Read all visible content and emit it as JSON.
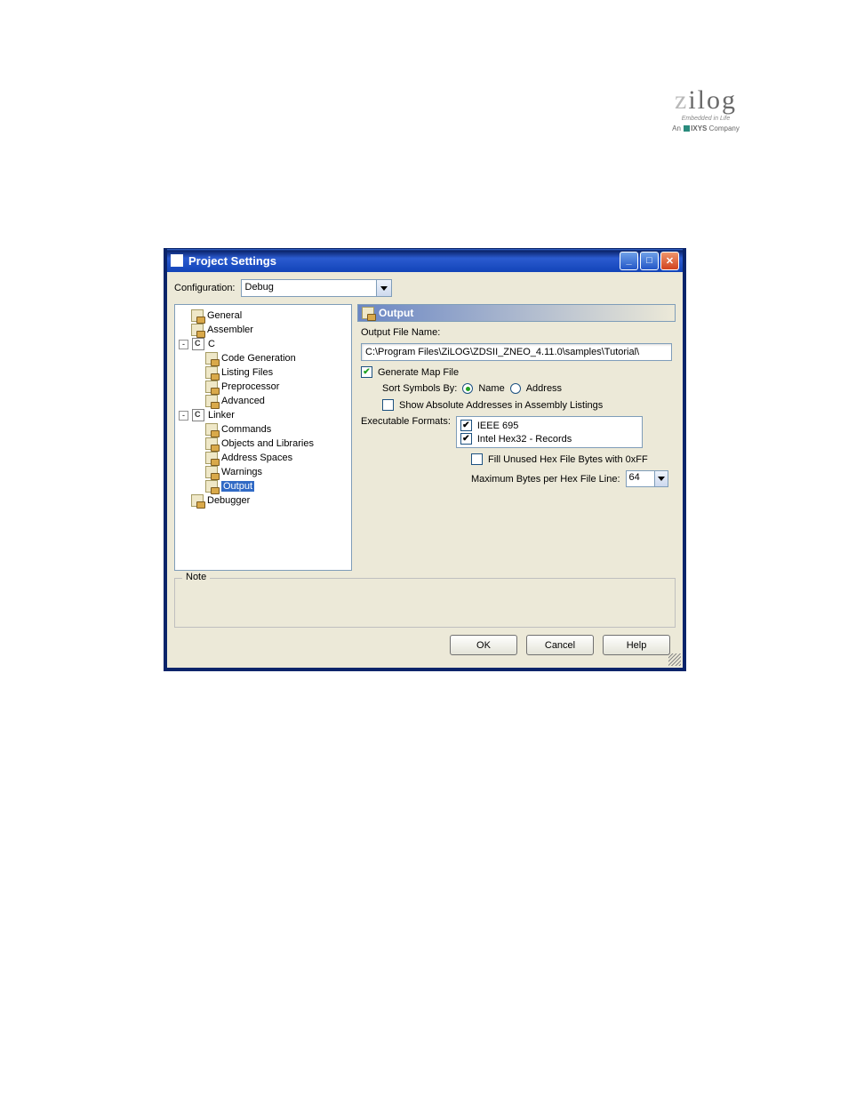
{
  "logo": {
    "brand": "zilog",
    "tagline": "Embedded in Life",
    "company": "An IXYS Company",
    "ixys": "IXYS"
  },
  "window": {
    "title": "Project Settings"
  },
  "config": {
    "label": "Configuration:",
    "value": "Debug"
  },
  "tree": {
    "general": "General",
    "assembler": "Assembler",
    "c": "C",
    "codegen": "Code Generation",
    "listing": "Listing Files",
    "preproc": "Preprocessor",
    "advanced": "Advanced",
    "linker": "Linker",
    "commands": "Commands",
    "objlib": "Objects and Libraries",
    "addrspaces": "Address Spaces",
    "warnings": "Warnings",
    "output": "Output",
    "debugger": "Debugger"
  },
  "section": {
    "title": "Output",
    "outFileLabel": "Output File Name:",
    "outFileValue": "C:\\Program Files\\ZiLOG\\ZDSII_ZNEO_4.11.0\\samples\\Tutorial\\",
    "genMap": "Generate Map File",
    "sortLabel": "Sort Symbols By:",
    "sortName": "Name",
    "sortAddr": "Address",
    "showAbs": "Show Absolute Addresses in Assembly Listings",
    "execFmtLabel": "Executable Formats:",
    "ieee": "IEEE 695",
    "hex32": "Intel Hex32 - Records",
    "fillFF": "Fill Unused Hex File Bytes with 0xFF",
    "maxBytesLabel": "Maximum Bytes per Hex File Line:",
    "maxBytesValue": "64"
  },
  "note": {
    "legend": "Note"
  },
  "buttons": {
    "ok": "OK",
    "cancel": "Cancel",
    "help": "Help"
  }
}
